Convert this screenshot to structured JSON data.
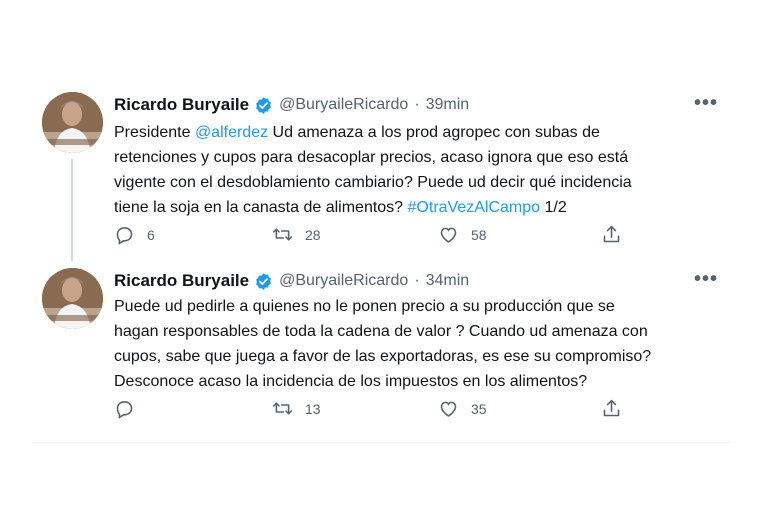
{
  "tweets": [
    {
      "author": "Ricardo Buryaile",
      "handle": "@BuryaileRicardo",
      "dot": "·",
      "time": "39min",
      "more": "•••",
      "text_before": "Presidente ",
      "mention": "@alferdez",
      "text_middle": " Ud amenaza a los prod agropec con subas de\nretenciones  y cupos para desacoplar precios, acaso ignora que eso está\nvigente con el desdoblamiento cambiario? Puede ud  decir qué incidencia\ntiene la soja en la canasta de alimentos? ",
      "hashtag": "#OtraVezAlCampo",
      "text_after": " 1/2",
      "replies": "6",
      "retweets": "28",
      "likes": "58"
    },
    {
      "author": "Ricardo Buryaile",
      "handle": "@BuryaileRicardo",
      "dot": "·",
      "time": "34min",
      "more": "•••",
      "text": "Puede ud pedirle a quienes no le ponen precio a su producción que se\nhagan responsables de toda la cadena de valor ? Cuando ud amenaza con\ncupos, sabe que juega a favor de las exportadoras, es ese su compromiso?\nDesconoce acaso la incidencia de los impuestos en los alimentos?",
      "replies": "",
      "retweets": "13",
      "likes": "35"
    }
  ],
  "icons": {
    "verified": "verified-badge-icon",
    "reply": "reply-icon",
    "retweet": "retweet-icon",
    "like": "heart-icon",
    "share": "share-icon",
    "more": "more-icon"
  },
  "colors": {
    "link": "#1d9bf0",
    "secondary_text": "#536471",
    "verified": "#1d9bf0"
  }
}
